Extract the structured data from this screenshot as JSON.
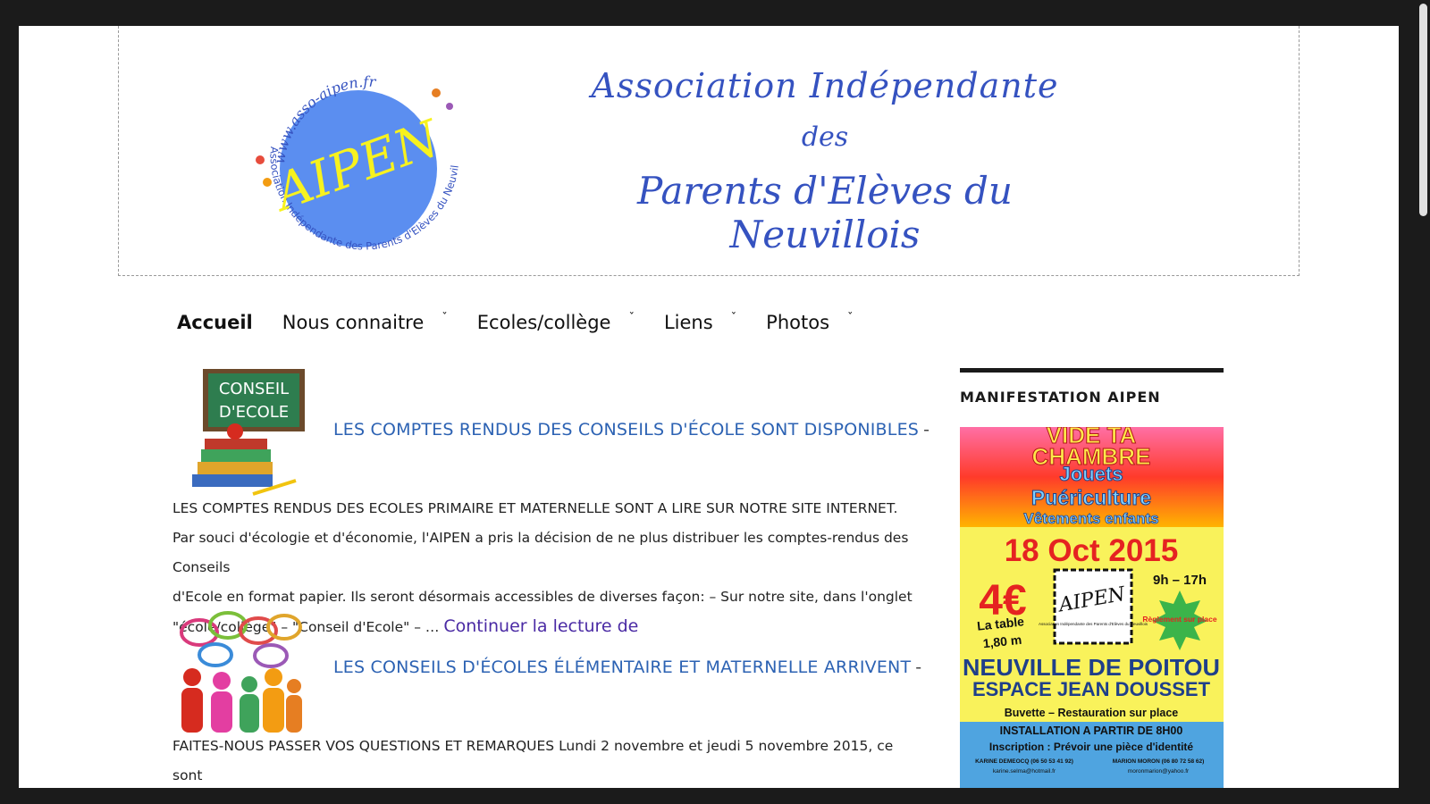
{
  "header": {
    "logo_circle_text": "AIPEN",
    "logo_url": "www.asso-aipen.fr",
    "logo_ring_text": "Association Indépendante des Parents d'Elèves du Neuvillois",
    "banner_line1": "Association Indépendante",
    "banner_line2": "des",
    "banner_line3": "Parents d'Elèves du Neuvillois"
  },
  "nav": {
    "items": [
      {
        "label": "Accueil",
        "dropdown": false
      },
      {
        "label": "Nous connaitre",
        "dropdown": true
      },
      {
        "label": "Ecoles/collège",
        "dropdown": true
      },
      {
        "label": "Liens",
        "dropdown": true
      },
      {
        "label": "Photos",
        "dropdown": true
      }
    ],
    "chevron_icon": "chevron-down-icon"
  },
  "posts": [
    {
      "thumb_text_line1": "CONSEIL",
      "thumb_text_line2": "D'ECOLE",
      "title": "LES COMPTES RENDUS DES CONSEILS D'ÉCOLE SONT DISPONIBLES",
      "separator": "-",
      "body_lines": [
        "LES COMPTES RENDUS DES ECOLES PRIMAIRE ET MATERNELLE SONT A LIRE SUR NOTRE SITE INTERNET.",
        "Par souci d'écologie et d'économie, l'AIPEN a pris la décision de ne plus distribuer les comptes-rendus des Conseils",
        "d'Ecole en format papier. Ils seront désormais accessibles de diverses façon: – Sur notre site, dans l'onglet",
        "\"école/collège\" – \"Conseil d'Ecole\" – …"
      ],
      "read_more": "Continuer la lecture de"
    },
    {
      "title": "LES CONSEILS D'ÉCOLES ÉLÉMENTAIRE ET MATERNELLE ARRIVENT",
      "separator": "-",
      "body_lines": [
        "FAITES-NOUS PASSER VOS QUESTIONS ET REMARQUES Lundi 2 novembre et jeudi 5 novembre 2015, ce sont"
      ]
    }
  ],
  "sidebar": {
    "widget_title": "MANIFESTATION AIPEN",
    "poster": {
      "line1": "VIDE TA",
      "line2": "CHAMBRE",
      "line3": "Jouets",
      "line4": "Puériculture",
      "line5": "Vêtements enfants",
      "date": "18 Oct 2015",
      "price": "4€",
      "price_note1": "La table",
      "price_note2": "1,80 m",
      "hours": "9h – 17h",
      "logo_text": "AIPEN",
      "logo_caption": "Association Indépendante des Parents d'Elèves du Neuvillois",
      "badge": "Règlement sur place",
      "town": "NEUVILLE DE POITOU",
      "venue": "ESPACE JEAN DOUSSET",
      "food": "Buvette – Restauration sur place",
      "install": "INSTALLATION A PARTIR DE 8H00",
      "inscription": "Inscription : Prévoir une pièce d'identité",
      "contact1": "KARINE DEMEOCQ (06 50 53 41 92)",
      "contact2": "MARION MORON (06 80 72 58 62)",
      "email1": "karine.selma@hotmail.fr",
      "email2": "moronmarion@yahoo.fr"
    }
  },
  "colors": {
    "link_blue": "#2c62b3",
    "read_more_purple": "#4a2aa4",
    "banner_blue": "#3552c0",
    "logo_blue": "#5b8ef0",
    "logo_yellow": "#f7f21e",
    "poster_yellow": "#f9f25b"
  }
}
